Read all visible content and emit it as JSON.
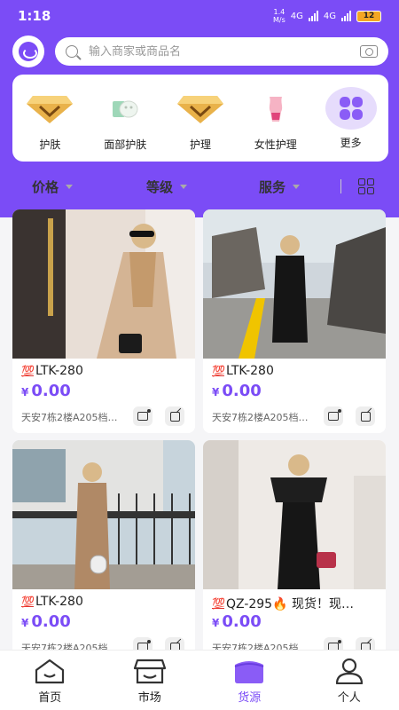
{
  "status": {
    "time": "1:18",
    "speed_value": "1.4",
    "speed_unit": "M/s",
    "net1": "4G",
    "net2": "4G",
    "battery": "12"
  },
  "search": {
    "placeholder": "输入商家或商品名"
  },
  "categories": [
    {
      "label": "护肤",
      "icon": "diamond-icon"
    },
    {
      "label": "面部护肤",
      "icon": "face-mask-icon"
    },
    {
      "label": "护理",
      "icon": "diamond-icon"
    },
    {
      "label": "女性护理",
      "icon": "body-icon"
    },
    {
      "label": "更多",
      "icon": "grid-more-icon"
    }
  ],
  "filters": [
    {
      "label": "价格"
    },
    {
      "label": "等级"
    },
    {
      "label": "服务"
    }
  ],
  "products": [
    {
      "badge": "💯",
      "title": "LTK-280",
      "currency": "¥",
      "price": "0.00",
      "shop": "天安7栋2楼A205档…"
    },
    {
      "badge": "💯",
      "title": "LTK-280",
      "currency": "¥",
      "price": "0.00",
      "shop": "天安7栋2楼A205档…"
    },
    {
      "badge": "💯",
      "title": "LTK-280",
      "currency": "¥",
      "price": "0.00",
      "shop": "天安7栋2楼A205档…"
    },
    {
      "badge": "💯",
      "title": "QZ-295🔥 现货！现…",
      "currency": "¥",
      "price": "0.00",
      "shop": "天安7栋2楼A205档…"
    }
  ],
  "tabs": [
    {
      "label": "首页",
      "icon": "home-icon"
    },
    {
      "label": "市场",
      "icon": "store-icon"
    },
    {
      "label": "货源",
      "icon": "box-icon",
      "active": true
    },
    {
      "label": "个人",
      "icon": "person-icon"
    }
  ],
  "colors": {
    "primary": "#7b4cf6",
    "price": "#7b4cf6",
    "badge": "#e0332f"
  }
}
